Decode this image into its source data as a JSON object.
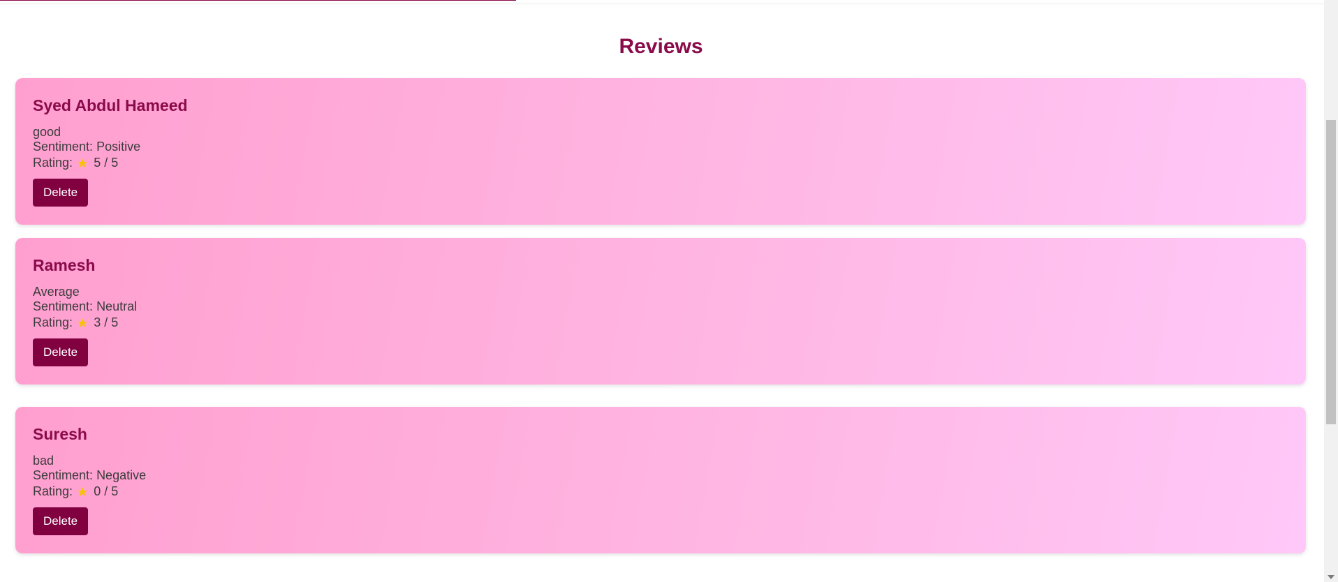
{
  "page": {
    "title": "Reviews",
    "scroll_position": 0.55
  },
  "top_progress": {
    "fraction": 0.39,
    "color": "#8a0b4a"
  },
  "theme": {
    "accent": "#8a0b4a",
    "button": "#800040",
    "card_gradient": [
      "#ff9fcf",
      "#ffc8f8"
    ],
    "star_color": "#f6c400"
  },
  "reviews": [
    {
      "name": "Syed Abdul Hameed",
      "text": "good",
      "sentiment_label": "Sentiment:",
      "sentiment": "Positive",
      "rating_label": "Rating:",
      "star_icon": "star-icon",
      "rating": "5 / 5",
      "delete_label": "Delete"
    },
    {
      "name": "Ramesh",
      "text": "Average",
      "sentiment_label": "Sentiment:",
      "sentiment": "Neutral",
      "rating_label": "Rating:",
      "star_icon": "star-icon",
      "rating": "3 / 5",
      "delete_label": "Delete"
    },
    {
      "name": "Suresh",
      "text": "bad",
      "sentiment_label": "Sentiment:",
      "sentiment": "Negative",
      "rating_label": "Rating:",
      "star_icon": "star-icon",
      "rating": "0 / 5",
      "delete_label": "Delete"
    }
  ]
}
